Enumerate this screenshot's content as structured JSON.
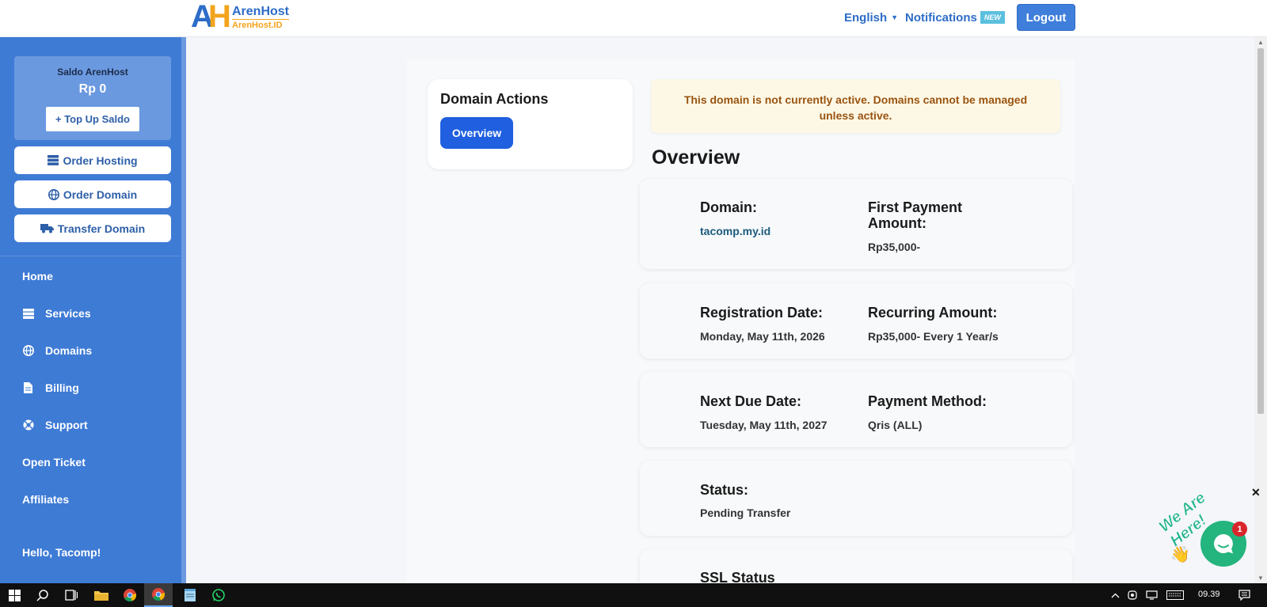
{
  "header": {
    "logo_main": "ArenHost",
    "logo_sub": "ArenHost.ID",
    "language": "English",
    "notifications": "Notifications",
    "notifications_badge": "NEW",
    "logout": "Logout"
  },
  "sidebar": {
    "saldo_title": "Saldo ArenHost",
    "saldo_value": "Rp 0",
    "topup_label": "+ Top Up Saldo",
    "buttons": [
      {
        "label": "Order Hosting",
        "icon": "server-icon"
      },
      {
        "label": "Order Domain",
        "icon": "globe-icon"
      },
      {
        "label": "Transfer Domain",
        "icon": "truck-icon"
      }
    ],
    "menu": [
      {
        "label": "Home"
      },
      {
        "label": "Services",
        "icon": "server-icon"
      },
      {
        "label": "Domains",
        "icon": "globe-icon"
      },
      {
        "label": "Billing",
        "icon": "invoice-icon"
      },
      {
        "label": "Support",
        "icon": "lifebuoy-icon"
      },
      {
        "label": "Open Ticket"
      },
      {
        "label": "Affiliates"
      },
      {
        "label": "Hello, Tacomp!"
      }
    ]
  },
  "actions": {
    "title": "Domain Actions",
    "overview_button": "Overview"
  },
  "alert": {
    "message": "This domain is not currently active. Domains cannot be managed unless active."
  },
  "overview": {
    "title": "Overview",
    "domain_label": "Domain:",
    "domain_value": "tacomp.my.id",
    "first_payment_label": "First Payment Amount:",
    "first_payment_value": "Rp35,000-",
    "registration_label": "Registration Date:",
    "registration_value": "Monday, May 11th, 2026",
    "recurring_label": "Recurring Amount:",
    "recurring_value": "Rp35,000- Every 1 Year/s",
    "next_due_label": "Next Due Date:",
    "next_due_value": "Tuesday, May 11th, 2027",
    "payment_method_label": "Payment Method:",
    "payment_method_value": "Qris (ALL)",
    "status_label": "Status:",
    "status_value": "Pending Transfer",
    "ssl_label": "SSL Status"
  },
  "chat": {
    "tagline": "We Are Here!",
    "badge_count": "1",
    "close": "✕"
  },
  "taskbar": {
    "time": "09.39"
  },
  "colors": {
    "sidebar": "#3e7bd5",
    "primary": "#1f5fe0",
    "accent": "#f2a41d",
    "alert_text": "#9a5410",
    "chat": "#24b47e"
  }
}
